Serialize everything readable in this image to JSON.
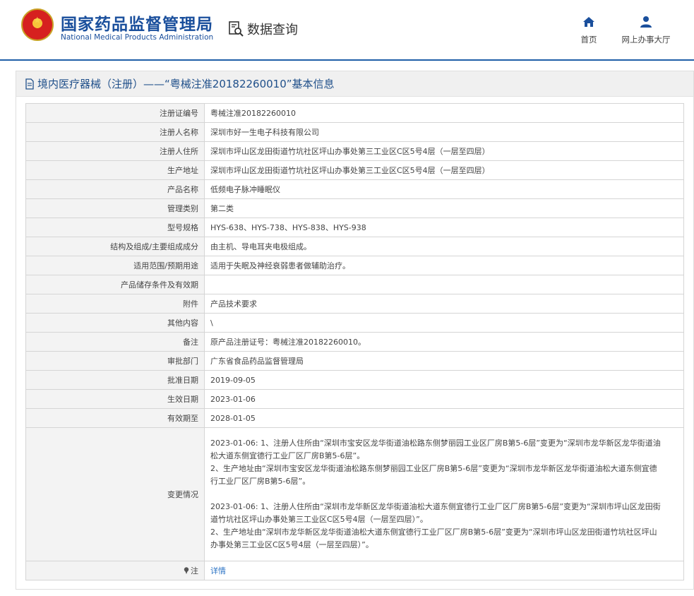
{
  "header": {
    "brand_cn": "国家药品监督管理局",
    "brand_en": "National Medical Products Administration",
    "search_title": "数据查询",
    "nav": [
      {
        "label": "首页",
        "icon": "home-icon"
      },
      {
        "label": "网上办事大厅",
        "icon": "user-icon"
      }
    ]
  },
  "panel": {
    "title": "境内医疗器械（注册）——“粤械注准20182260010”基本信息",
    "rows": [
      {
        "key": "注册证编号",
        "value": "粤械注准20182260010"
      },
      {
        "key": "注册人名称",
        "value": "深圳市好一生电子科技有限公司"
      },
      {
        "key": "注册人住所",
        "value": "深圳市坪山区龙田街道竹坑社区坪山办事处第三工业区C区5号4层（一层至四层）"
      },
      {
        "key": "生产地址",
        "value": "深圳市坪山区龙田街道竹坑社区坪山办事处第三工业区C区5号4层（一层至四层）"
      },
      {
        "key": "产品名称",
        "value": "低频电子脉冲睡眠仪"
      },
      {
        "key": "管理类别",
        "value": "第二类"
      },
      {
        "key": "型号规格",
        "value": "HYS-638、HYS-738、HYS-838、HYS-938"
      },
      {
        "key": "结构及组成/主要组成成分",
        "value": "由主机、导电耳夹电极组成。"
      },
      {
        "key": "适用范围/预期用途",
        "value": "适用于失眠及神经衰弱患者做辅助治疗。"
      },
      {
        "key": "产品储存条件及有效期",
        "value": ""
      },
      {
        "key": "附件",
        "value": "产品技术要求"
      },
      {
        "key": "其他内容",
        "value": "\\"
      },
      {
        "key": "备注",
        "value": "原产品注册证号：粤械注准20182260010。"
      },
      {
        "key": "审批部门",
        "value": "广东省食品药品监督管理局"
      },
      {
        "key": "批准日期",
        "value": "2019-09-05"
      },
      {
        "key": "生效日期",
        "value": "2023-01-06"
      },
      {
        "key": "有效期至",
        "value": "2028-01-05"
      }
    ],
    "change_label": "变更情况",
    "change_lines": [
      "2023-01-06: 1、注册人住所由“深圳市宝安区龙华街道油松路东侧梦丽园工业区厂房B第5-6层”变更为“深圳市龙华新区龙华街道油",
      "松大道东侧宜德行工业厂区厂房B第5-6层”。",
      "2、生产地址由“深圳市宝安区龙华街道油松路东侧梦丽园工业区厂房B第5-6层”变更为“深圳市龙华新区龙华街道油松大道东侧宜德",
      "行工业厂区厂房B第5-6层”。",
      "",
      "2023-01-06: 1、注册人住所由“深圳市龙华新区龙华街道油松大道东侧宜德行工业厂区厂房B第5-6层”变更为“深圳市坪山区龙田街",
      "道竹坑社区坪山办事处第三工业区C区5号4层（一层至四层）”。",
      "2、生产地址由“深圳市龙华新区龙华街道油松大道东侧宜德行工业厂区厂房B第5-6层”变更为“深圳市坪山区龙田街道竹坑社区坪山",
      "办事处第三工业区C区5号4层（一层至四层）”。"
    ],
    "note_label": "注",
    "note_link": "详情"
  }
}
